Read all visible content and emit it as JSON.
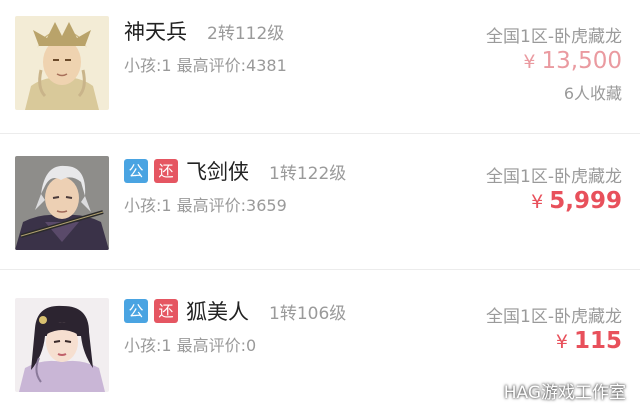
{
  "listings": [
    {
      "name": "神天兵",
      "badges": [],
      "level": "2转112级",
      "stats": "小孩:1 最高评价:4381",
      "server": "全国1区-卧虎藏龙",
      "price_symbol": "¥",
      "price": "13,500",
      "favorites": "6人收藏"
    },
    {
      "name": "飞剑侠",
      "badges": [
        "公",
        "还"
      ],
      "level": "1转122级",
      "stats": "小孩:1 最高评价:3659",
      "server": "全国1区-卧虎藏龙",
      "price_symbol": "¥",
      "price": "5,999"
    },
    {
      "name": "狐美人",
      "badges": [
        "公",
        "还"
      ],
      "level": "1转106级",
      "stats": "小孩:1 最高评价:0",
      "server": "全国1区-卧虎藏龙",
      "price_symbol": "¥",
      "price": "115"
    }
  ],
  "watermark": "HAG游戏工作室",
  "colors": {
    "price": "#e8505b",
    "badge_public": "#4aa4e2",
    "badge_return": "#e55662",
    "secondary_text": "#9a9a9a"
  }
}
